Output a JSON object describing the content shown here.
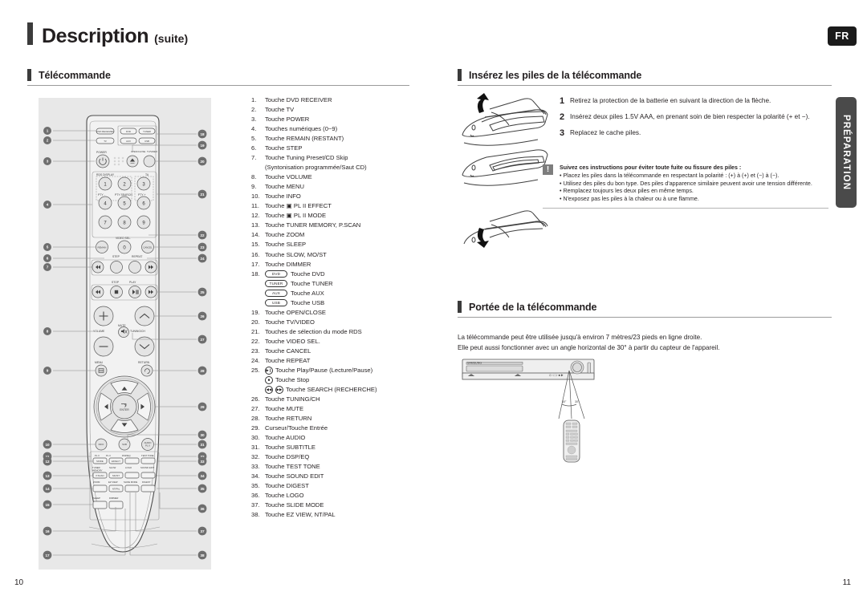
{
  "page": {
    "title_main": "Description",
    "title_sub": "(suite)",
    "lang_badge": "FR",
    "side_tab": "PRÉPARATION",
    "page_left": "10",
    "page_right": "11"
  },
  "sections": {
    "remote": {
      "title": "Télécommande"
    },
    "batteries": {
      "title": "Insérez les piles de la télécommande"
    },
    "range": {
      "title": "Portée de la télécommande"
    }
  },
  "remote_list": [
    {
      "n": "1.",
      "t": "Touche DVD RECEIVER"
    },
    {
      "n": "2.",
      "t": "Touche TV"
    },
    {
      "n": "3.",
      "t": "Touche POWER"
    },
    {
      "n": "4.",
      "t": "Touches numériques (0~9)"
    },
    {
      "n": "5.",
      "t": "Touche REMAIN (RESTANT)"
    },
    {
      "n": "6.",
      "t": "Touche STEP"
    },
    {
      "n": "7.",
      "t": "Touche Tuning Preset/CD Skip",
      "cont": "(Syntonisation programmée/Saut CD)"
    },
    {
      "n": "8.",
      "t": "Touche VOLUME"
    },
    {
      "n": "9.",
      "t": "Touche MENU"
    },
    {
      "n": "10.",
      "t": "Touche INFO"
    },
    {
      "n": "11.",
      "t": "Touche ▣ PL II EFFECT"
    },
    {
      "n": "12.",
      "t": "Touche ▣ PL II MODE"
    },
    {
      "n": "13.",
      "t": "Touche TUNER MEMORY, P.SCAN"
    },
    {
      "n": "14.",
      "t": "Touche ZOOM"
    },
    {
      "n": "15.",
      "t": "Touche SLEEP"
    },
    {
      "n": "16.",
      "t": "Touche SLOW, MO/ST"
    },
    {
      "n": "17.",
      "t": "Touche DIMMER"
    },
    {
      "n": "18.",
      "keycap": "DVD",
      "t": "Touche DVD",
      "subs": [
        {
          "keycap": "TUNER",
          "t": "Touche TUNER"
        },
        {
          "keycap": "AUX",
          "t": "Touche AUX"
        },
        {
          "keycap": "USB",
          "t": "Touche USB"
        }
      ]
    },
    {
      "n": "19.",
      "t": "Touche OPEN/CLOSE"
    },
    {
      "n": "20.",
      "t": "Touche TV/VIDEO"
    },
    {
      "n": "21.",
      "t": "Touches de sélection du mode RDS"
    },
    {
      "n": "22.",
      "t": "Touche VIDEO SEL."
    },
    {
      "n": "23.",
      "t": "Touche CANCEL"
    },
    {
      "n": "24.",
      "t": "Touche REPEAT"
    },
    {
      "n": "25.",
      "glyph": "play",
      "t": "Touche Play/Pause (Lecture/Pause)",
      "subs": [
        {
          "glyph": "stop",
          "t": "Touche Stop"
        },
        {
          "glyph": "search",
          "t": "Touche SEARCH (RECHERCHE)"
        }
      ]
    },
    {
      "n": "26.",
      "t": "Touche TUNING/CH"
    },
    {
      "n": "27.",
      "t": "Touche MUTE"
    },
    {
      "n": "28.",
      "t": "Touche RETURN"
    },
    {
      "n": "29.",
      "t": "Curseur/Touche Entrée"
    },
    {
      "n": "30.",
      "t": "Touche AUDIO"
    },
    {
      "n": "31.",
      "t": "Touche SUBTITLE"
    },
    {
      "n": "32.",
      "t": "Touche DSP/EQ"
    },
    {
      "n": "33.",
      "t": "Touche TEST TONE"
    },
    {
      "n": "34.",
      "t": "Touche SOUND EDIT"
    },
    {
      "n": "35.",
      "t": "Touche DIGEST"
    },
    {
      "n": "36.",
      "t": "Touche LOGO"
    },
    {
      "n": "37.",
      "t": "Touche SLIDE MODE"
    },
    {
      "n": "38.",
      "t": "Touche EZ VIEW, NT/PAL"
    }
  ],
  "battery_steps": [
    {
      "n": "1",
      "t": "Retirez la protection de la batterie en suivant la direction de la flèche."
    },
    {
      "n": "2",
      "t": "Insérez deux piles 1.5V AAA, en prenant soin de bien respecter la polarité (+ et −)."
    },
    {
      "n": "3",
      "t": "Replacez le cache piles."
    }
  ],
  "note": {
    "icon": "exclamation-icon",
    "title": "Suivez ces instructions pour éviter toute fuite ou fissure des piles :",
    "items": [
      "• Placez les piles dans la télécommande en respectant la polarité : (+) à (+) et (−) à (−).",
      "• Utilisez des piles du bon type. Des piles d'apparence similaire peuvent avoir une tension différente.",
      "• Remplacez toujours les deux piles en même temps.",
      "• N'exposez pas les piles à la chaleur ou à une flamme."
    ]
  },
  "range": {
    "line1": "La télécommande peut être utilisée jusqu'à environ 7 mètres/23 pieds en ligne droite.",
    "line2": "Elle peut aussi fonctionner avec un angle horizontal de 30° à partir du capteur de l'appareil.",
    "angle_left": "30°",
    "angle_right": "30°",
    "brand": "SAMSUNG"
  },
  "remote_diagram": {
    "callouts_left": [
      "1",
      "2",
      "3",
      "4",
      "5",
      "6",
      "7",
      "8",
      "9",
      "10",
      "11",
      "12",
      "13",
      "14",
      "15",
      "16",
      "17"
    ],
    "callouts_right": [
      "18",
      "19",
      "20",
      "21",
      "22",
      "23",
      "24",
      "25",
      "26",
      "27",
      "28",
      "29",
      "30",
      "31",
      "32",
      "33",
      "34",
      "35",
      "36",
      "37",
      "38"
    ],
    "labels": {
      "power": "POWER",
      "open_close": "OPEN/CLOSE",
      "tv_video": "TV/VIDEO",
      "rds_display": "RDS DISPLAY",
      "ta": "TA",
      "pty_minus": "PTY -",
      "pty_search": "PTY SEARCH",
      "pty_plus": "PTY +",
      "video_sel": "VIDEO SEL.",
      "step": "STEP",
      "repeat": "REPEAT",
      "stop": "STOP",
      "play": "PLAY",
      "volume": "VOLUME",
      "mute": "MUTE",
      "tuning_ch": "TUNING/CH",
      "menu": "MENU",
      "return": "RETURN",
      "enter": "ENTER",
      "info": "INFO",
      "subtitle": "SUB",
      "audio": "AUDIO",
      "pl2": "PL II",
      "dspeq": "DSP/EQ",
      "test_tone": "TEST TONE",
      "mode": "MODE",
      "effect": "EFFECT",
      "logo": "LOGO",
      "sound_edit": "SOUND EDIT",
      "tuner_memory": "TUNER MEMORY",
      "pscan": "P.SCAN",
      "slow": "SLOW",
      "moist": "MO/ST",
      "digest": "DIGEST",
      "zoom": "ZOOM",
      "ez_view": "EZ VIEW",
      "ntpal": "NT/PAL",
      "slide_mode": "SLIDE MODE",
      "sleep": "SLEEP",
      "dimmer": "DIMMER",
      "remain": "REMAIN",
      "cancel": "CANCEL",
      "dvd": "DVD",
      "tuner": "TUNER",
      "aux": "AUX",
      "usb": "USB",
      "tv": "TV",
      "receiver": "DVD RECEIVER",
      "num_1": "1",
      "num_2": "2",
      "num_3": "3",
      "num_4": "4",
      "num_5": "5",
      "num_6": "6",
      "num_7": "7",
      "num_8": "8",
      "num_9": "9",
      "num_0": "0"
    }
  }
}
